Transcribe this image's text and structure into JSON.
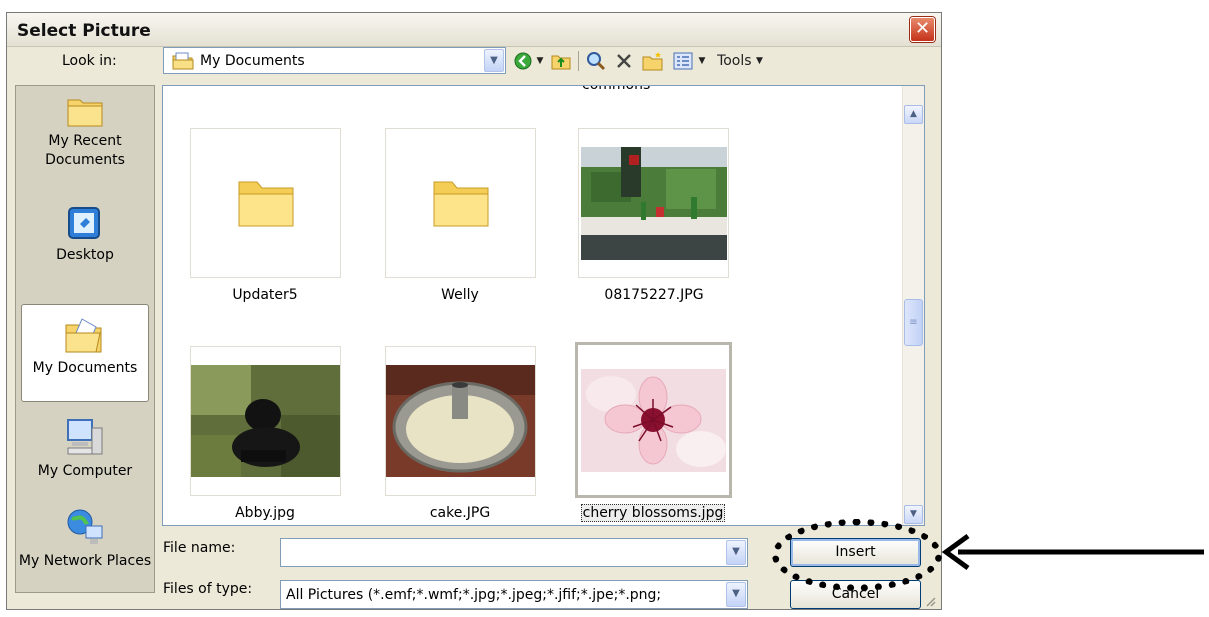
{
  "dialog": {
    "title": "Select Picture",
    "close_glyph": "✕"
  },
  "lookin": {
    "label": "Look in:",
    "value": "My Documents",
    "icon": "folder-icon"
  },
  "toolbar": {
    "back_icon": "back-icon",
    "up_icon": "up-folder-icon",
    "search_icon": "search-web-icon",
    "delete_icon": "delete-icon",
    "new_folder_icon": "new-folder-icon",
    "views_icon": "views-icon",
    "tools_label": "Tools"
  },
  "places": [
    {
      "label": "My Recent Documents",
      "icon": "recent-documents-icon"
    },
    {
      "label": "Desktop",
      "icon": "desktop-icon"
    },
    {
      "label": "My Documents",
      "icon": "my-documents-icon",
      "selected": true
    },
    {
      "label": "My Computer",
      "icon": "my-computer-icon"
    },
    {
      "label": "My Network Places",
      "icon": "network-places-icon"
    }
  ],
  "files": {
    "clipped_label": "commons",
    "items": [
      {
        "name": "Updater5",
        "type": "folder"
      },
      {
        "name": "Welly",
        "type": "folder"
      },
      {
        "name": "08175227.JPG",
        "type": "image"
      },
      {
        "name": "Abby.jpg",
        "type": "image"
      },
      {
        "name": "cake.JPG",
        "type": "image"
      },
      {
        "name": "cherry blossoms.jpg",
        "type": "image",
        "selected": true
      }
    ]
  },
  "filename": {
    "label": "File name:",
    "value": ""
  },
  "filetype": {
    "label": "Files of type:",
    "value": "All Pictures (*.emf;*.wmf;*.jpg;*.jpeg;*.jfif;*.jpe;*.png;"
  },
  "buttons": {
    "insert": "Insert",
    "cancel": "Cancel"
  },
  "annotation": {
    "target": "insert-button",
    "style": "dotted-ellipse-with-arrow",
    "color": "#000000"
  }
}
